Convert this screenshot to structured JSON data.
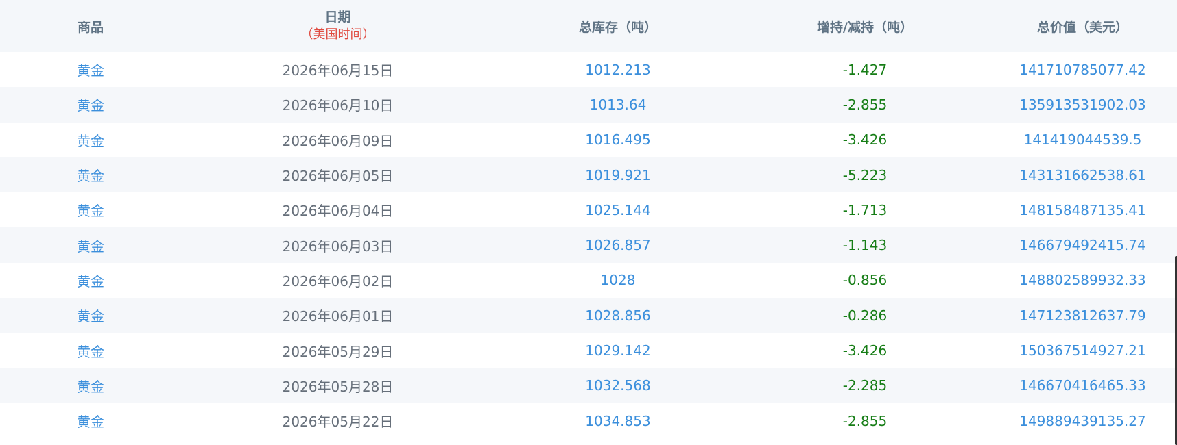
{
  "table": {
    "headers": {
      "commodity": "商品",
      "date": "日期",
      "date_note": "（美国时间）",
      "total": "总库存（吨）",
      "change": "增持/减持（吨）",
      "value": "总价值（美元）"
    },
    "rows": [
      {
        "commodity": "黄金",
        "date": "2026年06月15日",
        "total": "1012.213",
        "change": "-1.427",
        "value": "141710785077.42"
      },
      {
        "commodity": "黄金",
        "date": "2026年06月10日",
        "total": "1013.64",
        "change": "-2.855",
        "value": "135913531902.03"
      },
      {
        "commodity": "黄金",
        "date": "2026年06月09日",
        "total": "1016.495",
        "change": "-3.426",
        "value": "141419044539.5"
      },
      {
        "commodity": "黄金",
        "date": "2026年06月05日",
        "total": "1019.921",
        "change": "-5.223",
        "value": "143131662538.61"
      },
      {
        "commodity": "黄金",
        "date": "2026年06月04日",
        "total": "1025.144",
        "change": "-1.713",
        "value": "148158487135.41"
      },
      {
        "commodity": "黄金",
        "date": "2026年06月03日",
        "total": "1026.857",
        "change": "-1.143",
        "value": "146679492415.74"
      },
      {
        "commodity": "黄金",
        "date": "2026年06月02日",
        "total": "1028",
        "change": "-0.856",
        "value": "148802589932.33"
      },
      {
        "commodity": "黄金",
        "date": "2026年06月01日",
        "total": "1028.856",
        "change": "-0.286",
        "value": "147123812637.79"
      },
      {
        "commodity": "黄金",
        "date": "2026年05月29日",
        "total": "1029.142",
        "change": "-3.426",
        "value": "150367514927.21"
      },
      {
        "commodity": "黄金",
        "date": "2026年05月28日",
        "total": "1032.568",
        "change": "-2.285",
        "value": "146670416465.33"
      },
      {
        "commodity": "黄金",
        "date": "2026年05月22日",
        "total": "1034.853",
        "change": "-2.855",
        "value": "149889439135.27"
      }
    ]
  },
  "colors": {
    "header_bg": "#f4f7fa",
    "header_text": "#5f7384",
    "header_note": "#e04a3f",
    "link_blue": "#3b8fdc",
    "date_gray": "#666f7a",
    "decrease_green": "#167d16",
    "stripe": "#f5f7fa"
  }
}
